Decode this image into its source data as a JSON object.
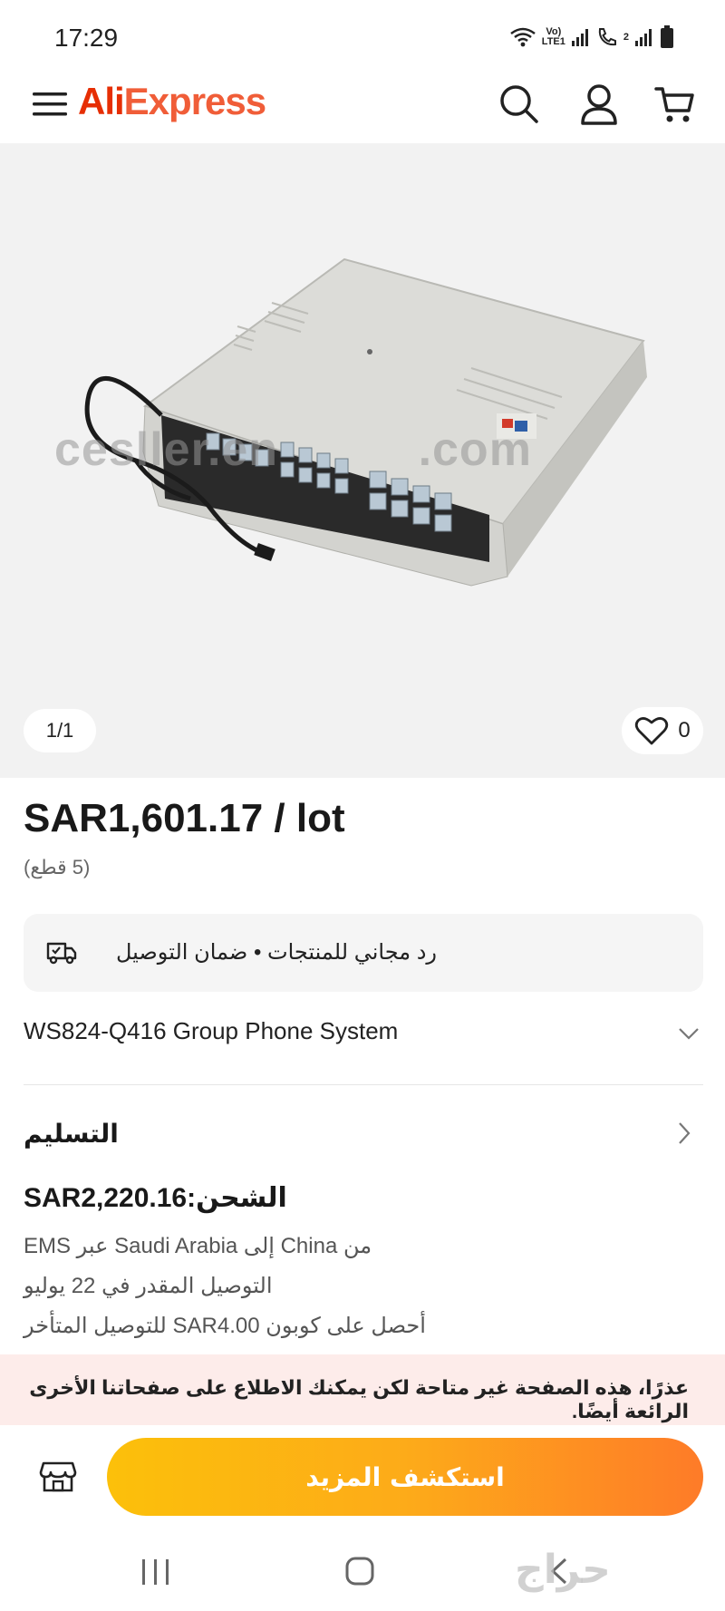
{
  "status_bar": {
    "time": "17:29",
    "volte_top": "Vo)",
    "volte_bottom": "LTE1",
    "sim2": "2"
  },
  "header": {
    "logo_ali": "Ali",
    "logo_express": "Express"
  },
  "gallery": {
    "watermark": "cesller.en",
    "watermark_tail": ".com",
    "counter": "1/1",
    "wishlist_count": "0"
  },
  "product": {
    "price": "SAR1,601.17 / lot",
    "quantity": "(5 قطع)",
    "guarantee": "رد مجاني للمنتجات • ضمان التوصيل",
    "variant": "WS824-Q416 Group Phone System"
  },
  "delivery": {
    "title": "التسليم",
    "shipping": "الشحن:SAR2,220.16",
    "route": "من China إلى Saudi Arabia عبر EMS",
    "eta": "التوصيل المقدر في 22 يوليو",
    "coupon": "أحصل على كوبون SAR4.00 للتوصيل المتأخر"
  },
  "notice": {
    "text": "عذرًا، هذه الصفحة غير متاحة لكن يمكنك الاطلاع على صفحاتنا الأخرى الرائعة أيضًا."
  },
  "actions": {
    "explore_label": "استكشف المزيد"
  },
  "nav": {
    "watermark": "حراج"
  },
  "colors": {
    "brand_red": "#e62e04",
    "brand_orange": "#f05d38",
    "button_start": "#fcc00a",
    "button_end": "#fe7b28",
    "notice_bg": "#fdecea"
  },
  "icons": [
    "menu-icon",
    "search-icon",
    "account-icon",
    "cart-icon",
    "heart-icon",
    "truck-icon",
    "chevron-down-icon",
    "chevron-right-icon",
    "store-icon"
  ]
}
